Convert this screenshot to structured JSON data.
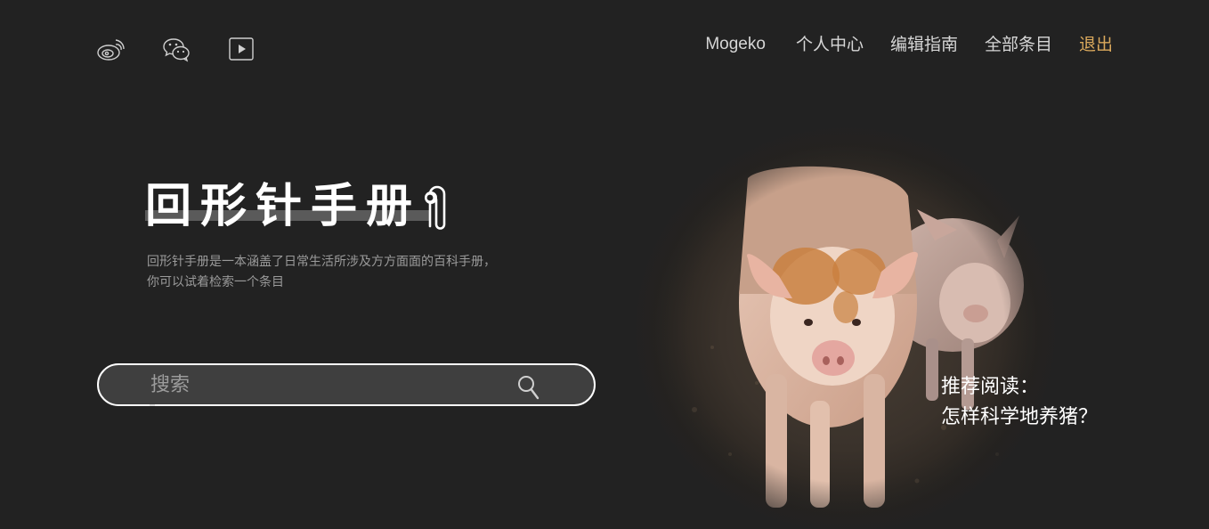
{
  "social": {
    "icons": [
      "weibo-icon",
      "wechat-icon",
      "video-play-icon"
    ]
  },
  "nav": {
    "user": "Mogeko",
    "items": [
      "个人中心",
      "编辑指南",
      "全部条目"
    ],
    "logout": "退出",
    "logout_color": "#d9a85c"
  },
  "logo": {
    "title": "回形针手册"
  },
  "description": {
    "line1": "回形针手册是一本涵盖了日常生活所涉及方方面面的百科手册，",
    "line2": "你可以试着检索一个条目"
  },
  "search": {
    "placeholder": "搜索"
  },
  "recommend": {
    "label": "推荐阅读：",
    "link": "怎样科学地养猪？"
  },
  "colors": {
    "background": "#222222",
    "accent": "#d9a85c"
  }
}
